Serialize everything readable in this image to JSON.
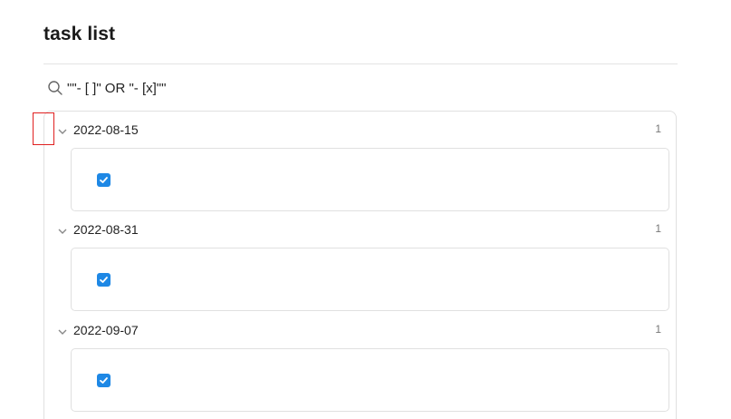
{
  "page": {
    "title": "task list"
  },
  "search": {
    "query": "\"\"- [ ]\" OR \"- [x]\"\""
  },
  "groups": [
    {
      "date": "2022-08-15",
      "count": "1",
      "checked": true
    },
    {
      "date": "2022-08-31",
      "count": "1",
      "checked": true
    },
    {
      "date": "2022-09-07",
      "count": "1",
      "checked": true
    }
  ],
  "colors": {
    "accent": "#1e88e5",
    "highlight": "#e02020"
  },
  "icons": {
    "search": "search-icon",
    "collapse": "chevron-down-icon",
    "checkbox": "check-icon"
  }
}
